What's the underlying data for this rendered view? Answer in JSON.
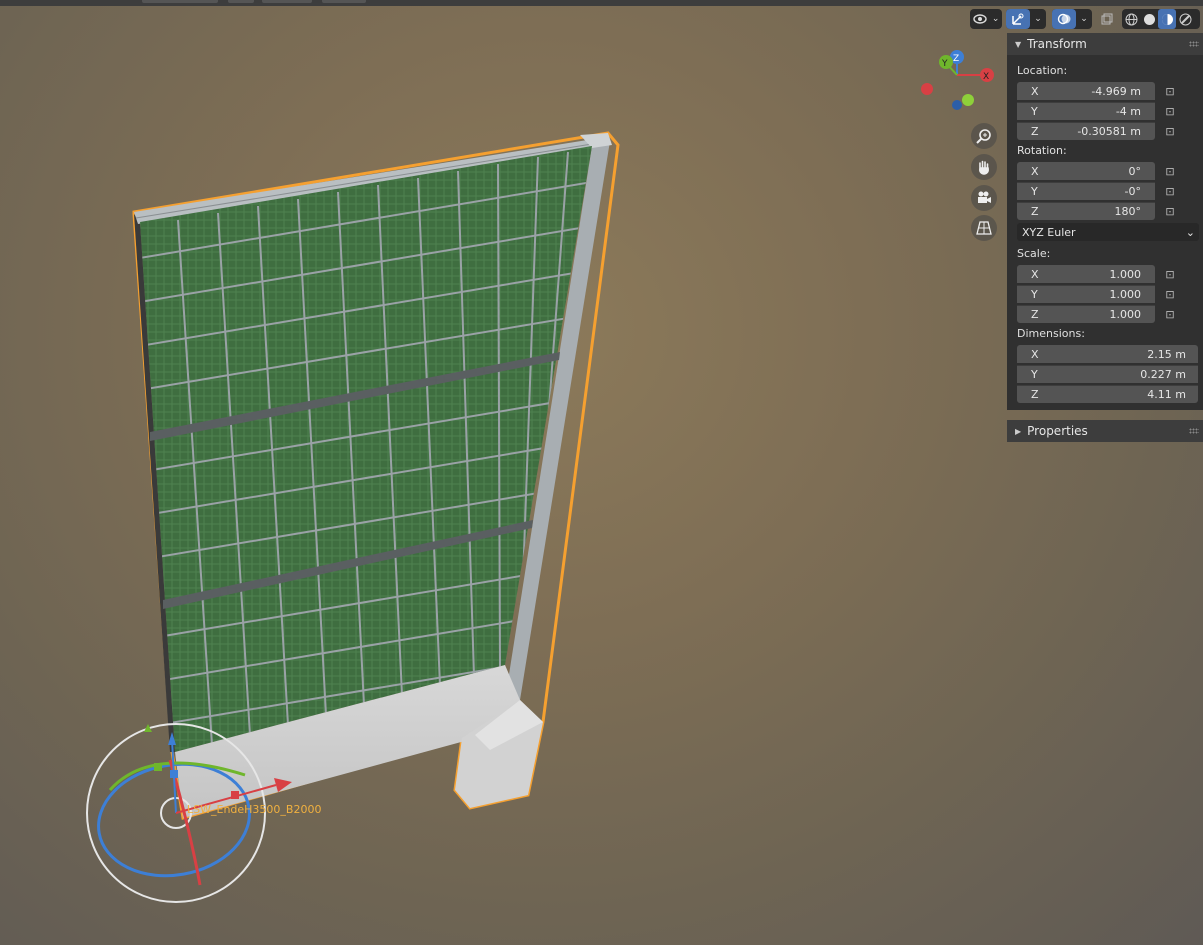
{
  "viewport": {
    "object_name": "LSW_EndeH3500_B2000",
    "header_icons": [
      "eye-icon",
      "gizmo-icon",
      "overlay-icon",
      "xray-icon",
      "wireframe-shading-icon",
      "solid-shading-icon",
      "material-shading-icon",
      "rendered-shading-icon"
    ],
    "nav_axes": [
      "X",
      "Y",
      "Z"
    ],
    "nav_buttons": [
      "zoom-icon",
      "hand-icon",
      "camera-icon",
      "grid-icon"
    ]
  },
  "transform": {
    "title": "Transform",
    "location_label": "Location:",
    "location": [
      {
        "axis": "X",
        "value": "-4.969 m"
      },
      {
        "axis": "Y",
        "value": "-4 m"
      },
      {
        "axis": "Z",
        "value": "-0.30581 m"
      }
    ],
    "rotation_label": "Rotation:",
    "rotation": [
      {
        "axis": "X",
        "value": "0°"
      },
      {
        "axis": "Y",
        "value": "-0°"
      },
      {
        "axis": "Z",
        "value": "180°"
      }
    ],
    "rotation_mode": "XYZ Euler",
    "scale_label": "Scale:",
    "scale": [
      {
        "axis": "X",
        "value": "1.000"
      },
      {
        "axis": "Y",
        "value": "1.000"
      },
      {
        "axis": "Z",
        "value": "1.000"
      }
    ],
    "dimensions_label": "Dimensions:",
    "dimensions": [
      {
        "axis": "X",
        "value": "2.15 m"
      },
      {
        "axis": "Y",
        "value": "0.227 m"
      },
      {
        "axis": "Z",
        "value": "4.11 m"
      }
    ]
  },
  "properties": {
    "title": "Properties"
  },
  "colors": {
    "selection": "#f5a030",
    "panel": "#303030",
    "field": "#545454",
    "accent": "#4772b3"
  }
}
